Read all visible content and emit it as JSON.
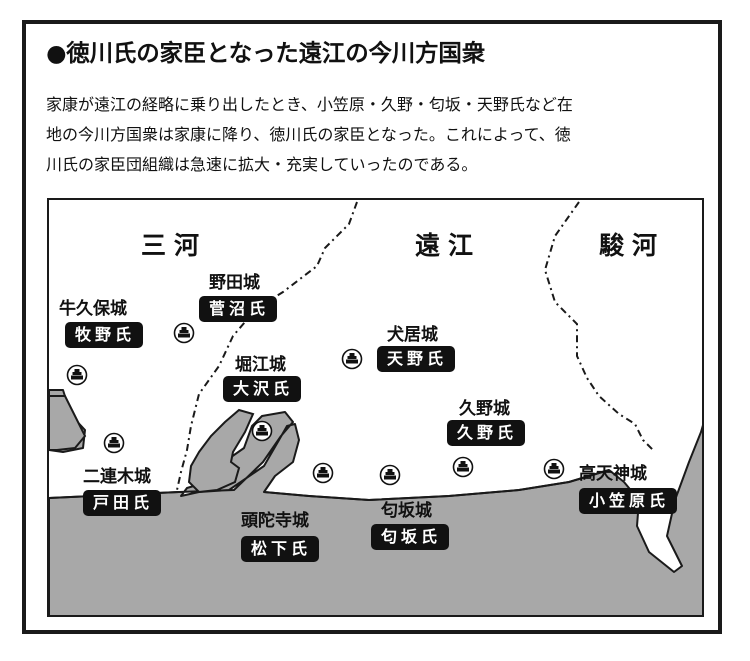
{
  "title": "●徳川氏の家臣となった遠江の今川方国衆",
  "description": [
    "家康が遠江の経略に乗り出したとき、小笠原・久野・匂坂・天野氏など在",
    "地の今川方国衆は家康に降り、徳川氏の家臣となった。これによって、徳",
    "川氏の家臣団組織は急速に拡大・充実していったのである。"
  ],
  "map": {
    "regions": [
      "三河",
      "遠江",
      "駿河"
    ],
    "castle_icon": "castle-marker-icon",
    "castles": [
      {
        "castle": "牛久保城",
        "clan": "牧野氏"
      },
      {
        "castle": "野田城",
        "clan": "菅沼氏"
      },
      {
        "castle": "堀江城",
        "clan": "大沢氏"
      },
      {
        "castle": "犬居城",
        "clan": "天野氏"
      },
      {
        "castle": "久野城",
        "clan": "久野氏"
      },
      {
        "castle": "高天神城",
        "clan": "小笠原氏"
      },
      {
        "castle": "二連木城",
        "clan": "戸田氏"
      },
      {
        "castle": "頭陀寺城",
        "clan": "松下氏"
      },
      {
        "castle": "匂坂城",
        "clan": "匂坂氏"
      }
    ]
  }
}
